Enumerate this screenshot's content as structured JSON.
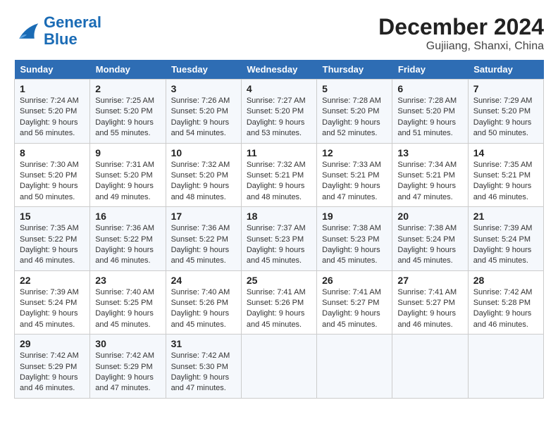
{
  "logo": {
    "line1": "General",
    "line2": "Blue"
  },
  "title": "December 2024",
  "subtitle": "Gujiiang, Shanxi, China",
  "headers": [
    "Sunday",
    "Monday",
    "Tuesday",
    "Wednesday",
    "Thursday",
    "Friday",
    "Saturday"
  ],
  "weeks": [
    [
      {
        "day": "1",
        "info": "Sunrise: 7:24 AM\nSunset: 5:20 PM\nDaylight: 9 hours and 56 minutes."
      },
      {
        "day": "2",
        "info": "Sunrise: 7:25 AM\nSunset: 5:20 PM\nDaylight: 9 hours and 55 minutes."
      },
      {
        "day": "3",
        "info": "Sunrise: 7:26 AM\nSunset: 5:20 PM\nDaylight: 9 hours and 54 minutes."
      },
      {
        "day": "4",
        "info": "Sunrise: 7:27 AM\nSunset: 5:20 PM\nDaylight: 9 hours and 53 minutes."
      },
      {
        "day": "5",
        "info": "Sunrise: 7:28 AM\nSunset: 5:20 PM\nDaylight: 9 hours and 52 minutes."
      },
      {
        "day": "6",
        "info": "Sunrise: 7:28 AM\nSunset: 5:20 PM\nDaylight: 9 hours and 51 minutes."
      },
      {
        "day": "7",
        "info": "Sunrise: 7:29 AM\nSunset: 5:20 PM\nDaylight: 9 hours and 50 minutes."
      }
    ],
    [
      {
        "day": "8",
        "info": "Sunrise: 7:30 AM\nSunset: 5:20 PM\nDaylight: 9 hours and 50 minutes."
      },
      {
        "day": "9",
        "info": "Sunrise: 7:31 AM\nSunset: 5:20 PM\nDaylight: 9 hours and 49 minutes."
      },
      {
        "day": "10",
        "info": "Sunrise: 7:32 AM\nSunset: 5:20 PM\nDaylight: 9 hours and 48 minutes."
      },
      {
        "day": "11",
        "info": "Sunrise: 7:32 AM\nSunset: 5:21 PM\nDaylight: 9 hours and 48 minutes."
      },
      {
        "day": "12",
        "info": "Sunrise: 7:33 AM\nSunset: 5:21 PM\nDaylight: 9 hours and 47 minutes."
      },
      {
        "day": "13",
        "info": "Sunrise: 7:34 AM\nSunset: 5:21 PM\nDaylight: 9 hours and 47 minutes."
      },
      {
        "day": "14",
        "info": "Sunrise: 7:35 AM\nSunset: 5:21 PM\nDaylight: 9 hours and 46 minutes."
      }
    ],
    [
      {
        "day": "15",
        "info": "Sunrise: 7:35 AM\nSunset: 5:22 PM\nDaylight: 9 hours and 46 minutes."
      },
      {
        "day": "16",
        "info": "Sunrise: 7:36 AM\nSunset: 5:22 PM\nDaylight: 9 hours and 46 minutes."
      },
      {
        "day": "17",
        "info": "Sunrise: 7:36 AM\nSunset: 5:22 PM\nDaylight: 9 hours and 45 minutes."
      },
      {
        "day": "18",
        "info": "Sunrise: 7:37 AM\nSunset: 5:23 PM\nDaylight: 9 hours and 45 minutes."
      },
      {
        "day": "19",
        "info": "Sunrise: 7:38 AM\nSunset: 5:23 PM\nDaylight: 9 hours and 45 minutes."
      },
      {
        "day": "20",
        "info": "Sunrise: 7:38 AM\nSunset: 5:24 PM\nDaylight: 9 hours and 45 minutes."
      },
      {
        "day": "21",
        "info": "Sunrise: 7:39 AM\nSunset: 5:24 PM\nDaylight: 9 hours and 45 minutes."
      }
    ],
    [
      {
        "day": "22",
        "info": "Sunrise: 7:39 AM\nSunset: 5:24 PM\nDaylight: 9 hours and 45 minutes."
      },
      {
        "day": "23",
        "info": "Sunrise: 7:40 AM\nSunset: 5:25 PM\nDaylight: 9 hours and 45 minutes."
      },
      {
        "day": "24",
        "info": "Sunrise: 7:40 AM\nSunset: 5:26 PM\nDaylight: 9 hours and 45 minutes."
      },
      {
        "day": "25",
        "info": "Sunrise: 7:41 AM\nSunset: 5:26 PM\nDaylight: 9 hours and 45 minutes."
      },
      {
        "day": "26",
        "info": "Sunrise: 7:41 AM\nSunset: 5:27 PM\nDaylight: 9 hours and 45 minutes."
      },
      {
        "day": "27",
        "info": "Sunrise: 7:41 AM\nSunset: 5:27 PM\nDaylight: 9 hours and 46 minutes."
      },
      {
        "day": "28",
        "info": "Sunrise: 7:42 AM\nSunset: 5:28 PM\nDaylight: 9 hours and 46 minutes."
      }
    ],
    [
      {
        "day": "29",
        "info": "Sunrise: 7:42 AM\nSunset: 5:29 PM\nDaylight: 9 hours and 46 minutes."
      },
      {
        "day": "30",
        "info": "Sunrise: 7:42 AM\nSunset: 5:29 PM\nDaylight: 9 hours and 47 minutes."
      },
      {
        "day": "31",
        "info": "Sunrise: 7:42 AM\nSunset: 5:30 PM\nDaylight: 9 hours and 47 minutes."
      },
      {
        "day": "",
        "info": ""
      },
      {
        "day": "",
        "info": ""
      },
      {
        "day": "",
        "info": ""
      },
      {
        "day": "",
        "info": ""
      }
    ]
  ]
}
